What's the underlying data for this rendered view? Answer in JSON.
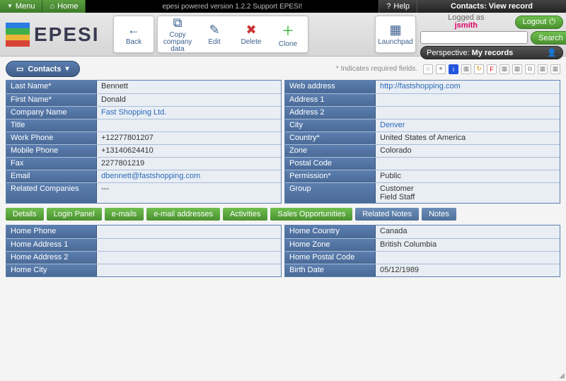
{
  "topbar": {
    "menu": "Menu",
    "home": "Home",
    "mid": "epesi powered  version 1.2.2   Support EPESI!",
    "help": "Help",
    "title": "Contacts: View record"
  },
  "logo": {
    "text": "EPESI"
  },
  "tools": {
    "back": "Back",
    "copy": "Copy company data",
    "edit": "Edit",
    "delete": "Delete",
    "clone": "Clone",
    "launchpad": "Launchpad"
  },
  "account": {
    "logged_as": "Logged as",
    "user": "jsmith",
    "logout": "Logout",
    "search": "Search",
    "perspective_label": "Perspective:",
    "perspective_value": "My records"
  },
  "section": {
    "title": "Contacts",
    "required_note": "* Indicates required fields."
  },
  "fields_left": {
    "last_name": {
      "label": "Last Name*",
      "value": "Bennett"
    },
    "first_name": {
      "label": "First Name*",
      "value": "Donald"
    },
    "company": {
      "label": "Company Name",
      "value": "Fast Shopping Ltd."
    },
    "title": {
      "label": "Title",
      "value": ""
    },
    "work_phone": {
      "label": "Work Phone",
      "value": "+12277801207"
    },
    "mobile_phone": {
      "label": "Mobile Phone",
      "value": "+13140624410"
    },
    "fax": {
      "label": "Fax",
      "value": "2277801219"
    },
    "email": {
      "label": "Email",
      "value": "dbennett@fastshopping.com"
    },
    "related": {
      "label": "Related Companies",
      "value": "---"
    }
  },
  "fields_right": {
    "web": {
      "label": "Web address",
      "value": "http://fastshopping.com"
    },
    "addr1": {
      "label": "Address 1",
      "value": ""
    },
    "addr2": {
      "label": "Address 2",
      "value": ""
    },
    "city": {
      "label": "City",
      "value": "Denver"
    },
    "country": {
      "label": "Country*",
      "value": "United States of America"
    },
    "zone": {
      "label": "Zone",
      "value": "Colorado"
    },
    "postal": {
      "label": "Postal Code",
      "value": ""
    },
    "permission": {
      "label": "Permission*",
      "value": "Public"
    },
    "group": {
      "label": "Group",
      "value": "Customer\nField Staff"
    }
  },
  "tabs": {
    "details": "Details",
    "login": "Login Panel",
    "emails": "e-mails",
    "emailaddr": "e-mail addresses",
    "activities": "Activities",
    "sales": "Sales Opportunities",
    "related_notes": "Related Notes",
    "notes": "Notes"
  },
  "details_left": {
    "home_phone": {
      "label": "Home Phone",
      "value": ""
    },
    "home_addr1": {
      "label": "Home Address 1",
      "value": ""
    },
    "home_addr2": {
      "label": "Home Address 2",
      "value": ""
    },
    "home_city": {
      "label": "Home City",
      "value": ""
    }
  },
  "details_right": {
    "home_country": {
      "label": "Home Country",
      "value": "Canada"
    },
    "home_zone": {
      "label": "Home Zone",
      "value": "British Columbia"
    },
    "home_postal": {
      "label": "Home Postal Code",
      "value": ""
    },
    "birth": {
      "label": "Birth Date",
      "value": "05/12/1989"
    }
  }
}
